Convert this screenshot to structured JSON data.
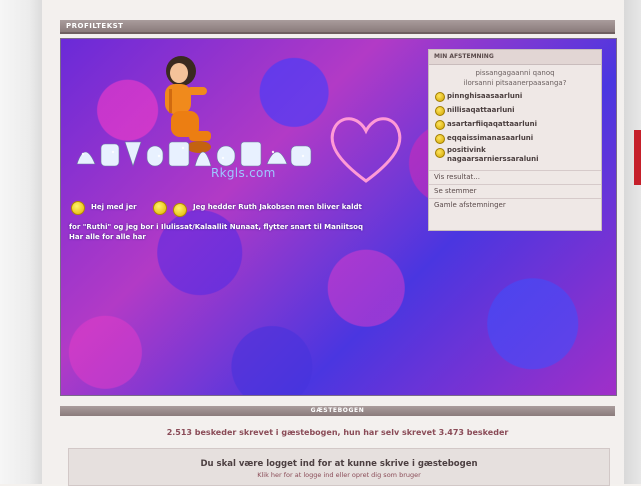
{
  "profile": {
    "section_title": "PROFILTEKST",
    "logo_sub": "Rkgls.com",
    "bio": {
      "line1_a": "Hej med jer",
      "line1_b": "Jeg hedder Ruth Jakobsen men bliver kaldt",
      "line2": "for \"Ruthi\" og jeg bor i Ilulissat/Kalaallit Nunaat, flytter snart til Maniitsoq",
      "line3": "Har alle for alle har"
    }
  },
  "poll": {
    "header": "MIN AFSTEMNING",
    "question_line1": "pissangagaanni qanoq",
    "question_line2": "ilorsanni pitsaanerpaasanga?",
    "options": [
      {
        "label": "pinnghisaasaarluni"
      },
      {
        "label": "nillisaqattaarluni"
      },
      {
        "label": "asartarfiiqaqattaarluni"
      },
      {
        "label": "eqqaissimanasaarluni"
      },
      {
        "label": "positivink",
        "label2": "nagaarsarnierssaraluni"
      }
    ],
    "links": [
      "Vis resultat...",
      "Se stemmer",
      "Gamle afstemninger"
    ]
  },
  "guestbook": {
    "section_title": "GÆSTEBOGEN",
    "stats": "2.513 beskeder skrevet i gæstebogen, hun har selv skrevet 3.473 beskeder",
    "login_title": "Du skal være logget ind for at kunne skrive i gæstebogen",
    "login_sub": "Klik her for at logge ind eller opret dig som bruger"
  }
}
